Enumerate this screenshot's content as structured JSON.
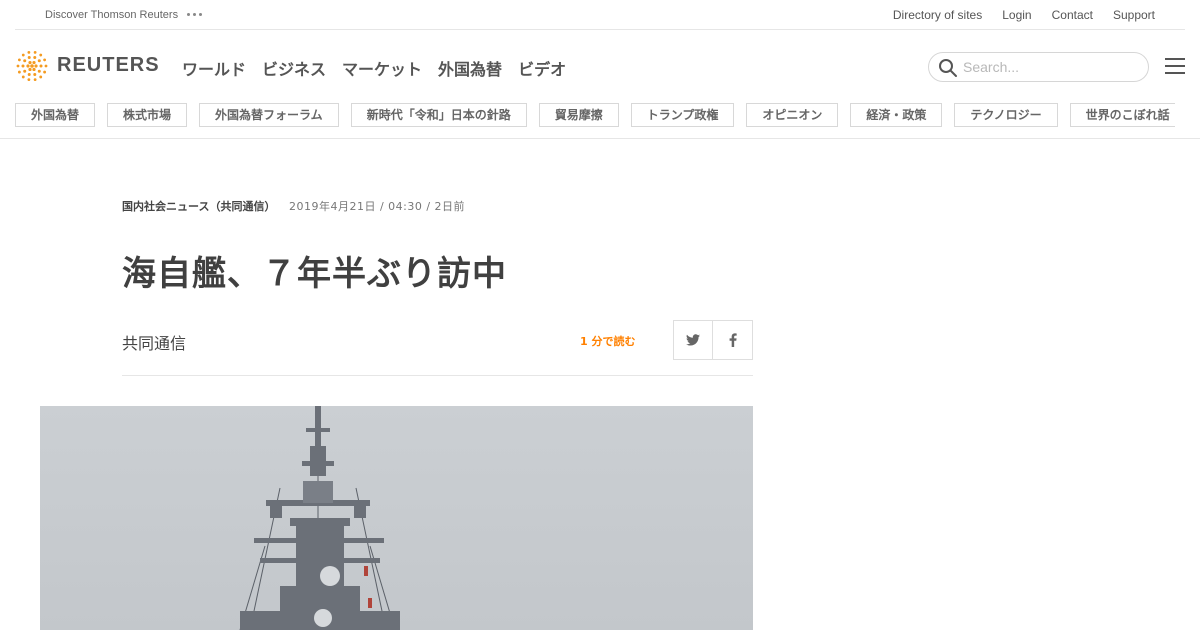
{
  "topbar": {
    "discover": "Discover Thomson Reuters",
    "links": [
      "Directory of sites",
      "Login",
      "Contact",
      "Support"
    ]
  },
  "header": {
    "logo_text": "REUTERS",
    "nav": [
      "ワールド",
      "ビジネス",
      "マーケット",
      "外国為替",
      "ビデオ"
    ],
    "search_placeholder": "Search..."
  },
  "topics": [
    "外国為替",
    "株式市場",
    "外国為替フォーラム",
    "新時代「令和」日本の針路",
    "貿易摩擦",
    "トランプ政権",
    "オピニオン",
    "経済・政策",
    "テクノロジー",
    "世界のこぼれ話"
  ],
  "article": {
    "section": "国内社会ニュース（共同通信）",
    "date": "2019年4月21日 / 04:30 / 2日前",
    "headline": "海自艦、７年半ぶり訪中",
    "byline": "共同通信",
    "read_time": "1 分で読む"
  },
  "colors": {
    "accent_orange": "#ff8000",
    "logo_orange": "#f49b21"
  },
  "icons": {
    "search": "search-icon",
    "menu": "hamburger-menu-icon",
    "twitter": "twitter-icon",
    "facebook": "facebook-icon",
    "more": "more-dots-icon"
  }
}
